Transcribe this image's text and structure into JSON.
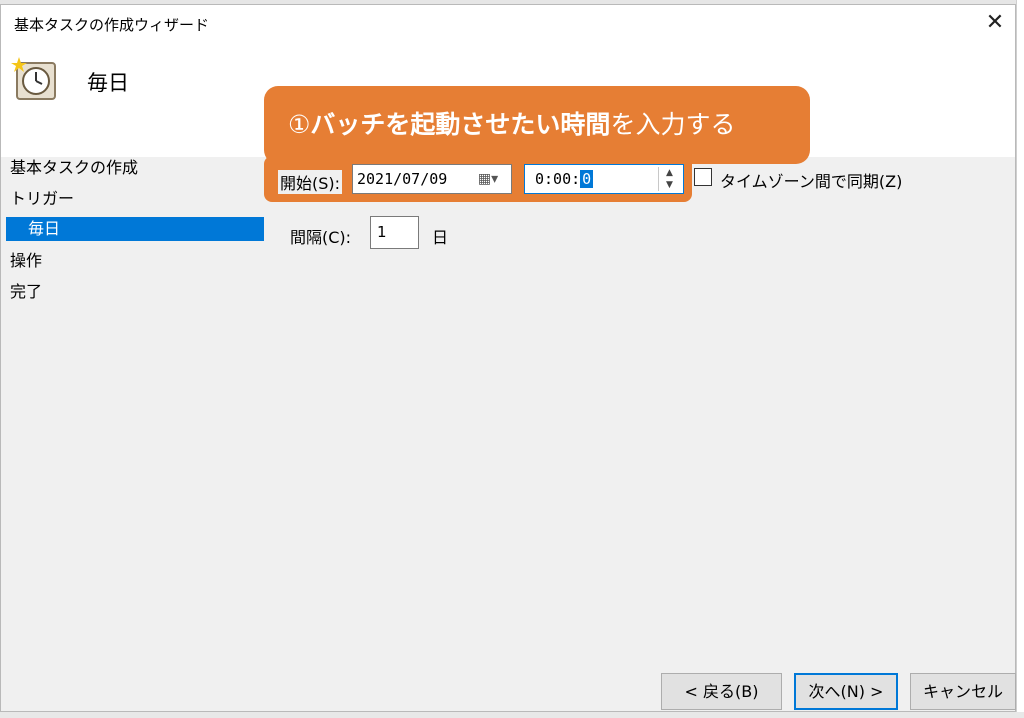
{
  "window": {
    "title": "基本タスクの作成ウィザード",
    "close_glyph": "✕"
  },
  "header": {
    "title": "毎日",
    "icon": "clock-icon"
  },
  "callout": {
    "circled_number": "①",
    "bold_text": "バッチを起動させたい時間",
    "rest_text": "を入力する",
    "color": "#e67e34"
  },
  "nav": {
    "items": [
      {
        "label": "基本タスクの作成",
        "selected": false
      },
      {
        "label": "トリガー",
        "selected": false
      },
      {
        "label": "毎日",
        "selected": true
      },
      {
        "label": "操作",
        "selected": false
      },
      {
        "label": "完了",
        "selected": false
      }
    ],
    "selected_color": "#0078d7"
  },
  "trigger": {
    "start_label": "開始(S):",
    "date_value": "2021/07/09",
    "time_prefix": "0:00:",
    "time_selected": "0",
    "tz_sync_label": "タイムゾーン間で同期(Z)",
    "tz_sync_checked": false,
    "interval_label": "間隔(C):",
    "interval_value": "1",
    "interval_unit": "日"
  },
  "buttons": {
    "back": "< 戻る(B)",
    "next": "次へ(N) >",
    "cancel": "キャンセル"
  }
}
